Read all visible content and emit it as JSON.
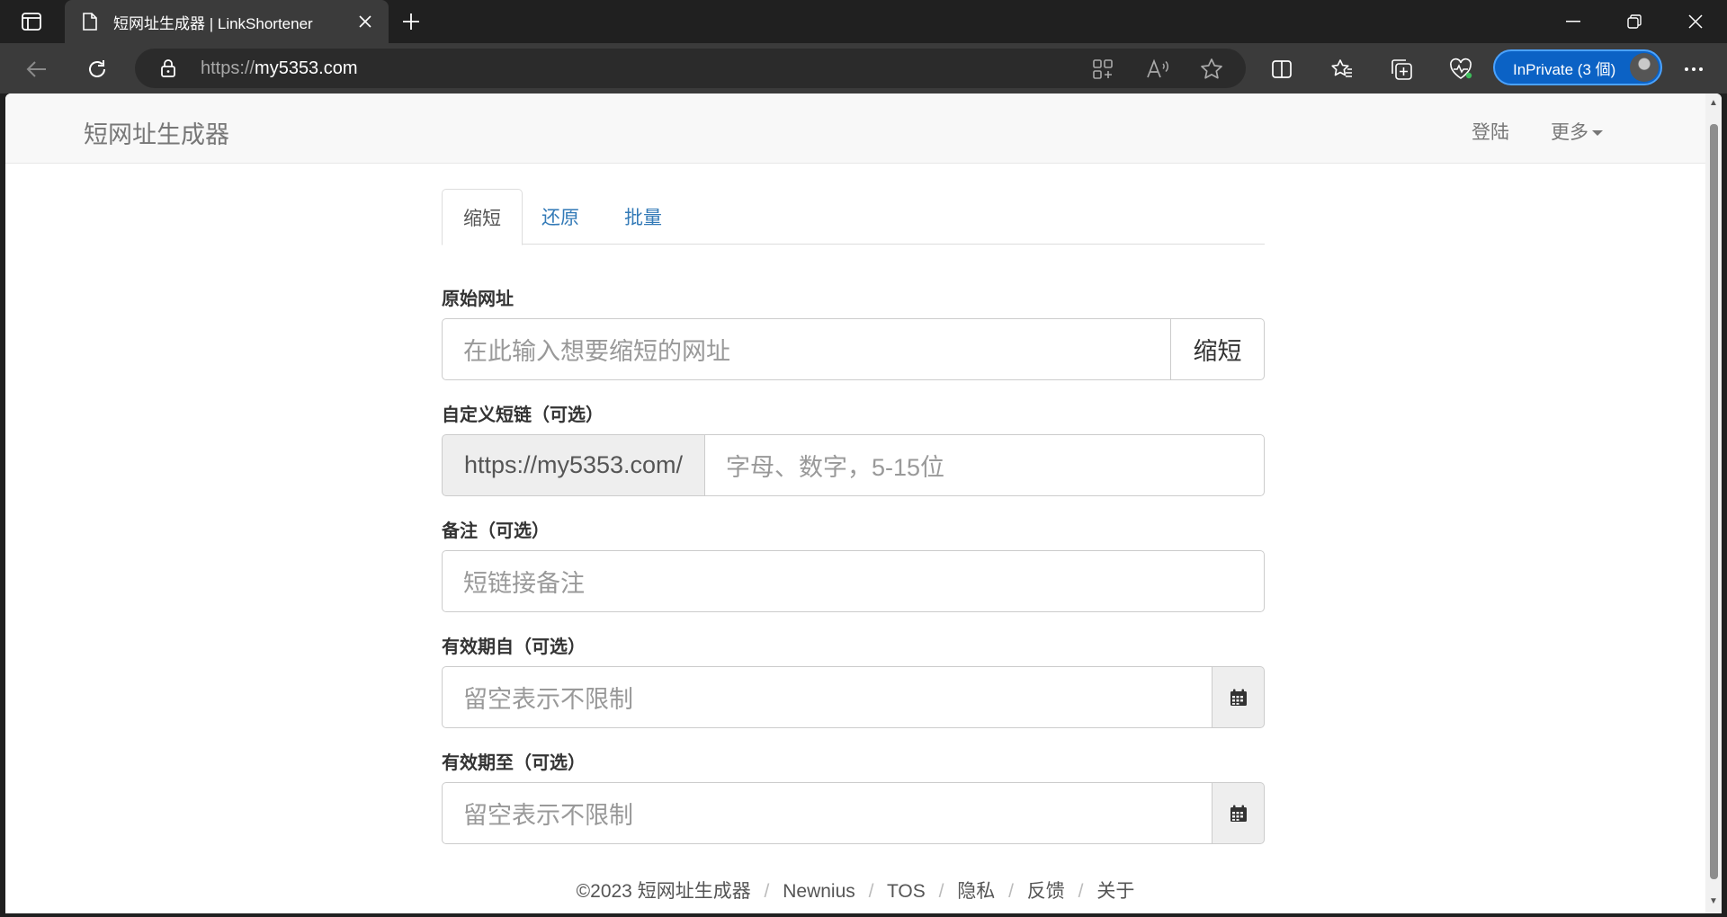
{
  "browser": {
    "tab_title": "短网址生成器 | LinkShortener",
    "url_protocol": "https://",
    "url_host": "my5353.com",
    "inprivate_label": "InPrivate (3 個)",
    "icons": [
      "tab-actions-icon",
      "page-icon",
      "close-icon",
      "plus-icon",
      "minimize-icon",
      "restore-icon",
      "close-window-icon",
      "back-icon",
      "refresh-icon",
      "lock-icon",
      "app-available-icon",
      "read-aloud-icon",
      "favorite-star-icon",
      "split-screen-icon",
      "favorites-icon",
      "collections-icon",
      "browser-essentials-icon",
      "more-icon"
    ]
  },
  "navbar": {
    "brand": "短网址生成器",
    "login": "登陆",
    "more": "更多"
  },
  "tabs": [
    {
      "label": "缩短",
      "active": true
    },
    {
      "label": "还原",
      "active": false
    },
    {
      "label": "批量",
      "active": false
    }
  ],
  "form": {
    "url_label": "原始网址",
    "url_placeholder": "在此输入想要缩短的网址",
    "shorten_button": "缩短",
    "custom_label": "自定义短链（可选）",
    "custom_prefix": "https://my5353.com/",
    "custom_placeholder": "字母、数字，5-15位",
    "note_label": "备注（可选）",
    "note_placeholder": "短链接备注",
    "valid_from_label": "有效期自（可选）",
    "valid_from_placeholder": "留空表示不限制",
    "valid_to_label": "有效期至（可选）",
    "valid_to_placeholder": "留空表示不限制"
  },
  "footer": {
    "copyright": "©2023 短网址生成器",
    "links": [
      "Newnius",
      "TOS",
      "隐私",
      "反馈",
      "关于"
    ],
    "separator": "/"
  },
  "colors": {
    "link": "#337ab7",
    "inprivate_bg": "#0b62c5",
    "navbar_bg": "#f8f8f8",
    "addon_bg": "#eeeeee"
  }
}
